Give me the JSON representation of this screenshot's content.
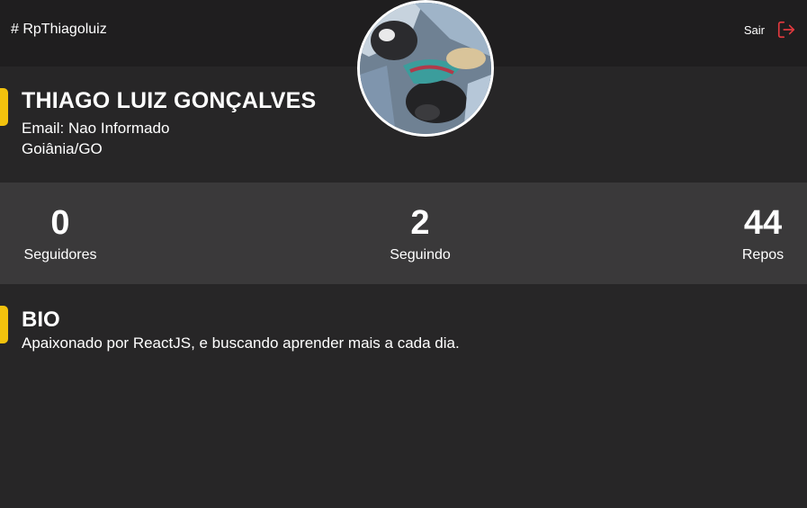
{
  "header": {
    "username": "# RpThiagoluiz",
    "logout_label": "Sair",
    "logout_icon": "logout-icon"
  },
  "avatar": {
    "icon": "user-avatar-photo"
  },
  "profile": {
    "name": "THIAGO LUIZ GONÇALVES",
    "email": "Email: Nao Informado",
    "location": "Goiânia/GO"
  },
  "stats": [
    {
      "value": "0",
      "label": "Seguidores"
    },
    {
      "value": "2",
      "label": "Seguindo"
    },
    {
      "value": "44",
      "label": "Repos"
    }
  ],
  "bio": {
    "title": "BIO",
    "text": "Apaixonado por ReactJS, e buscando aprender mais a cada dia."
  },
  "colors": {
    "accent": "#f2c20d",
    "logout_icon": "#e0393e",
    "header_bg": "#1f1e1f",
    "page_bg": "#272627",
    "stats_bg": "#3a393a"
  }
}
